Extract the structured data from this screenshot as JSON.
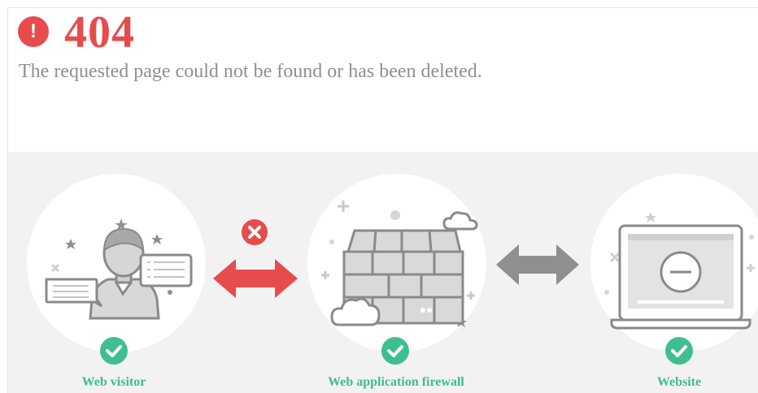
{
  "error": {
    "icon": "exclamation-circle-icon",
    "icon_glyph": "!",
    "code": "404",
    "message": "The requested page could not be found or has been deleted."
  },
  "diagram": {
    "nodes": [
      {
        "label": "Web visitor",
        "icon": "user-avatar-icon",
        "status_icon": "check-icon",
        "status": "ok"
      },
      {
        "label": "Web application firewall",
        "icon": "brick-wall-icon",
        "status_icon": "check-icon",
        "status": "ok"
      },
      {
        "label": "Website",
        "icon": "laptop-icon",
        "status_icon": "check-icon",
        "status": "ok"
      }
    ],
    "links": [
      {
        "from": "Web visitor",
        "to": "Web application firewall",
        "status": "blocked",
        "icon": "error-x-icon"
      },
      {
        "from": "Web application firewall",
        "to": "Website",
        "status": "ok"
      }
    ]
  },
  "colors": {
    "error": "#e74c4c",
    "success": "#3fbf8f",
    "message_text": "#8f8f8f",
    "panel_bg": "#f2f2f2",
    "neutral_arrow": "#8f8f8f"
  }
}
